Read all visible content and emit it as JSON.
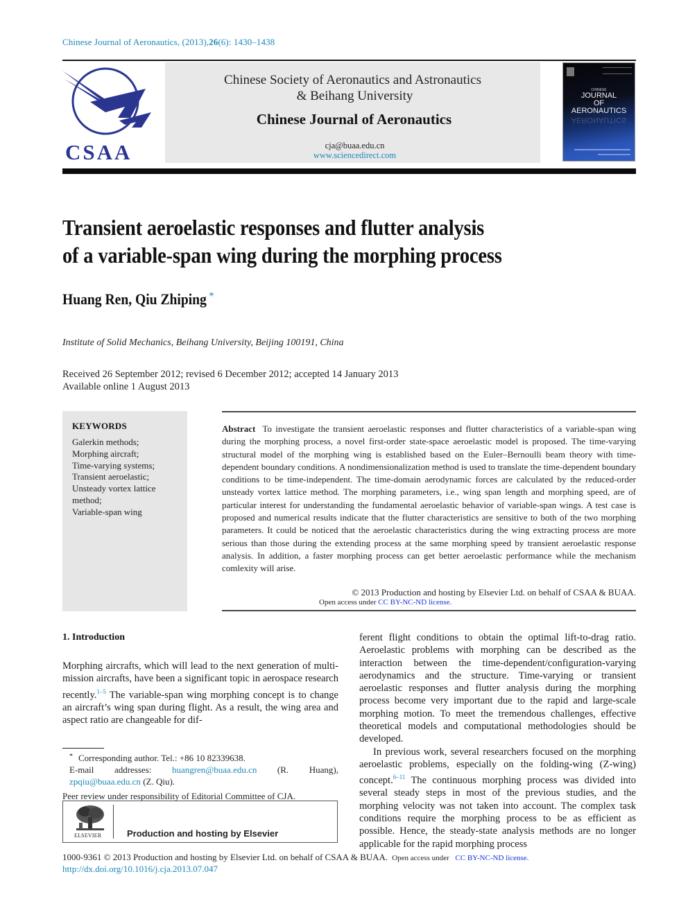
{
  "citation": {
    "journal": "Chinese Journal of Aeronautics, (2013),",
    "volume": "26",
    "issue_pages": "(6): 1430–1438"
  },
  "masthead": {
    "logo_text": "CSAA",
    "society_line1": "Chinese Society of Aeronautics and Astronautics",
    "society_line2": "& Beihang University",
    "journal_name": "Chinese Journal of Aeronautics",
    "email": "cja@buaa.edu.cn",
    "url": "www.sciencedirect.com",
    "cover": {
      "small_title": "CHINESE",
      "title_lines": [
        "JOURNAL",
        "OF",
        "AERONAUTICS"
      ]
    },
    "colors": {
      "logo_blue": "#2a3590",
      "link": "#1b87b8"
    }
  },
  "article": {
    "title_line1": "Transient aeroelastic responses and flutter analysis",
    "title_line2": "of a variable-span wing during the morphing process",
    "authors": "Huang Ren, Qiu Zhiping",
    "author_mark": "*",
    "affiliation": "Institute of Solid Mechanics, Beihang University, Beijing 100191, China",
    "dates_line1": "Received 26 September 2012; revised 6 December 2012; accepted 14 January 2013",
    "dates_line2": "Available online 1 August 2013"
  },
  "keywords": {
    "title": "KEYWORDS",
    "items": [
      "Galerkin methods;",
      "Morphing aircraft;",
      "Time-varying systems;",
      "Transient aeroelastic;",
      "Unsteady vortex lattice method;",
      "Variable-span wing"
    ]
  },
  "abstract": {
    "label": "Abstract",
    "text": "To investigate the transient aeroelastic responses and flutter characteristics of a variable-span wing during the morphing process, a novel first-order state-space aeroelastic model is proposed. The time-varying structural model of the morphing wing is established based on the Euler–Bernoulli beam theory with time-dependent boundary conditions. A nondimensionalization method is used to translate the time-dependent boundary conditions to be time-independent. The time-domain aerodynamic forces are calculated by the reduced-order unsteady vortex lattice method. The morphing parameters, i.e., wing span length and morphing speed, are of particular interest for understanding the fundamental aeroelastic behavior of variable-span wings. A test case is proposed and numerical results indicate that the flutter characteristics are sensitive to both of the two morphing parameters. It could be noticed that the aeroelastic characteristics during the wing extracting process are more serious than those during the extending process at the same morphing speed by transient aeroelastic response analysis. In addition, a faster morphing process can get better aeroelastic performance while the mechanism comlexity will arise.",
    "copyright": "© 2013 Production and hosting by Elsevier Ltd. on behalf of CSAA & BUAA.",
    "open_access_prefix": "Open access under ",
    "license": "CC BY-NC-ND license."
  },
  "introduction": {
    "heading": "1. Introduction",
    "left_p1_a": "Morphing aircrafts, which will lead to the next generation of multi-mission aircrafts, have been a significant topic in aerospace research recently.",
    "left_ref1": "1–5",
    "left_p1_b": " The variable-span wing morphing concept is to change an aircraft’s wing span during flight. As a result, the wing area and aspect ratio are changeable for dif-",
    "right_p1": "ferent flight conditions to obtain the optimal lift-to-drag ratio. Aeroelastic problems with morphing can be described as the interaction between the time-dependent/configuration-varying aerodynamics and the structure. Time-varying or transient aeroelastic responses and flutter analysis during the morphing process become very important due to the rapid and large-scale morphing motion. To meet the tremendous challenges, effective theoretical models and computational methodologies should be developed.",
    "right_p2_a": "In previous work, several researchers focused on the morphing aeroelastic problems, especially on the folding-wing (Z-wing) concept.",
    "right_ref2": "6–11",
    "right_p2_b": " The continuous morphing process was divided into several steady steps in most of the previous studies, and the morphing velocity was not taken into account. The complex task conditions require the morphing process to be as efficient as possible. Hence, the steady-state analysis methods are no longer applicable for the rapid morphing process"
  },
  "footnotes": {
    "asterisk": "*",
    "corresponding": "Corresponding author. Tel.: +86 10 82339638.",
    "email_prefix": "E-mail addresses: ",
    "email1": "huangren@buaa.edu.cn",
    "email1_name": " (R. Huang), ",
    "email2": "zpqiu@buaa.edu.cn",
    "email2_name": " (Z. Qiu).",
    "peer_review": "Peer review under responsibility of Editorial Committee of CJA."
  },
  "elsevier_box": {
    "wordmark": "ELSEVIER",
    "text": "Production and hosting by Elsevier"
  },
  "footer": {
    "issn_copyright": "1000-9361 © 2013 Production and hosting by Elsevier Ltd. on behalf of CSAA & BUAA.",
    "open_access_prefix": "Open access under ",
    "license": "CC BY-NC-ND license.",
    "doi": "http://dx.doi.org/10.1016/j.cja.2013.07.047"
  }
}
